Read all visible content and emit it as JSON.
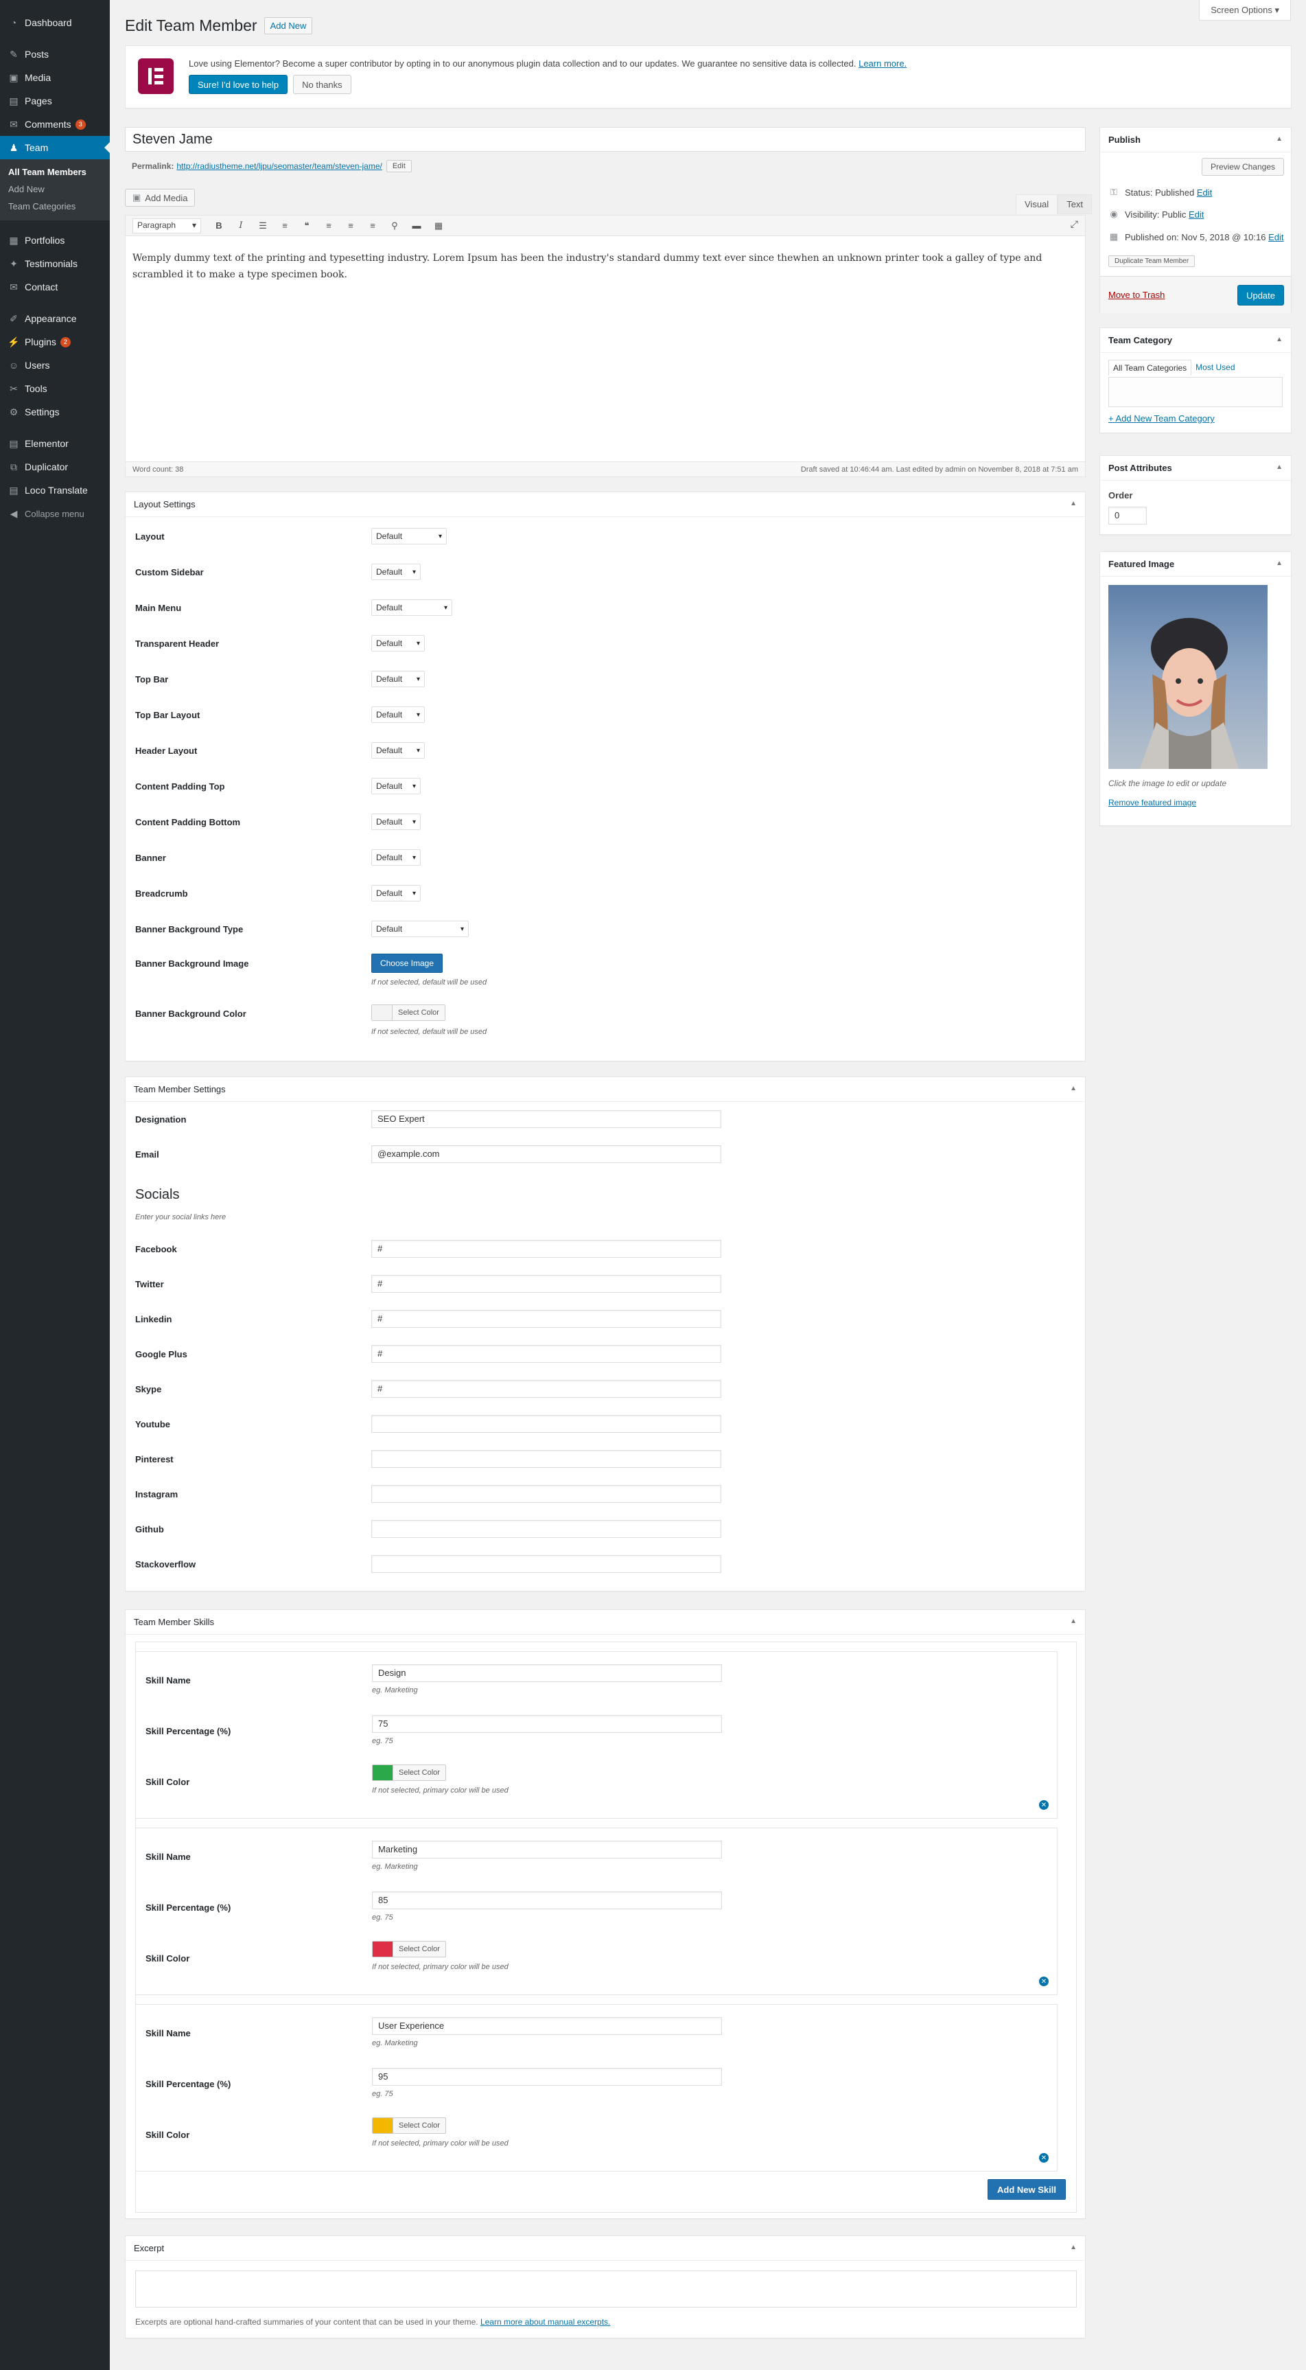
{
  "sidebar": {
    "items": [
      {
        "label": "Dashboard",
        "icon": "dashboard-icon",
        "glyph": "◔"
      },
      {
        "label": "Posts",
        "icon": "pin-icon",
        "glyph": "✎"
      },
      {
        "label": "Media",
        "icon": "media-icon",
        "glyph": "▣"
      },
      {
        "label": "Pages",
        "icon": "pages-icon",
        "glyph": "▤"
      },
      {
        "label": "Comments",
        "icon": "comments-icon",
        "glyph": "✉",
        "badge": "3"
      },
      {
        "label": "Team",
        "icon": "team-icon",
        "glyph": "♟"
      },
      {
        "label": "Portfolios",
        "icon": "portfolio-icon",
        "glyph": "▦"
      },
      {
        "label": "Testimonials",
        "icon": "testimonial-icon",
        "glyph": "✦"
      },
      {
        "label": "Contact",
        "icon": "mail-icon",
        "glyph": "✉"
      },
      {
        "label": "Appearance",
        "icon": "appearance-icon",
        "glyph": "✐"
      },
      {
        "label": "Plugins",
        "icon": "plugins-icon",
        "glyph": "⚡",
        "badge": "2"
      },
      {
        "label": "Users",
        "icon": "users-icon",
        "glyph": "☺"
      },
      {
        "label": "Tools",
        "icon": "tools-icon",
        "glyph": "✂"
      },
      {
        "label": "Settings",
        "icon": "settings-icon",
        "glyph": "⚙"
      },
      {
        "label": "Elementor",
        "icon": "elementor-icon",
        "glyph": "▤"
      },
      {
        "label": "Duplicator",
        "icon": "duplicator-icon",
        "glyph": "⧉"
      },
      {
        "label": "Loco Translate",
        "icon": "translate-icon",
        "glyph": "▤"
      }
    ],
    "submenu": [
      "All Team Members",
      "Add New",
      "Team Categories"
    ],
    "collapse": "Collapse menu"
  },
  "header": {
    "screen_options": "Screen Options ▾",
    "title": "Edit Team Member",
    "add_new": "Add New"
  },
  "notice": {
    "text": "Love using Elementor? Become a super contributor by opting in to our anonymous plugin data collection and to our updates. We guarantee no sensitive data is collected.",
    "learn_more": "Learn more.",
    "accept": "Sure! I'd love to help",
    "decline": "No thanks"
  },
  "post": {
    "title": "Steven Jame",
    "permalink_label": "Permalink:",
    "permalink_url": "http://radiustheme.net/ljpu/seomaster/team/steven-jame/",
    "edit": "Edit"
  },
  "editor": {
    "add_media": "Add Media",
    "tab_visual": "Visual",
    "tab_text": "Text",
    "format": "Paragraph",
    "content": "Wemply dummy text of the printing and typesetting industry. Lorem Ipsum has been the industry's standard dummy text ever since thewhen an unknown printer took a galley of type and scrambled it to make a type specimen book.",
    "word_count": "Word count: 38",
    "draft_saved": "Draft saved at 10:46:44 am. Last edited by admin on November 8, 2018 at 7:51 am"
  },
  "layout_settings": {
    "title": "Layout Settings",
    "rows": [
      {
        "label": "Layout",
        "value": "Default"
      },
      {
        "label": "Custom Sidebar",
        "value": "Default"
      },
      {
        "label": "Main Menu",
        "value": "Default"
      },
      {
        "label": "Transparent Header",
        "value": "Default"
      },
      {
        "label": "Top Bar",
        "value": "Default"
      },
      {
        "label": "Top Bar Layout",
        "value": "Default"
      },
      {
        "label": "Header Layout",
        "value": "Default"
      },
      {
        "label": "Content Padding Top",
        "value": "Default"
      },
      {
        "label": "Content Padding Bottom",
        "value": "Default"
      },
      {
        "label": "Banner",
        "value": "Default"
      },
      {
        "label": "Breadcrumb",
        "value": "Default"
      },
      {
        "label": "Banner Background Type",
        "value": "Default"
      }
    ],
    "bg_image_label": "Banner Background Image",
    "choose_image": "Choose Image",
    "bg_image_help": "If not selected, default will be used",
    "bg_color_label": "Banner Background Color",
    "select_color": "Select Color",
    "bg_color_help": "If not selected, default will be used"
  },
  "member_settings": {
    "title": "Team Member Settings",
    "designation_label": "Designation",
    "designation": "SEO Expert",
    "email_label": "Email",
    "email": "@example.com",
    "socials_title": "Socials",
    "socials_help": "Enter your social links here",
    "socials": [
      {
        "label": "Facebook",
        "value": "#"
      },
      {
        "label": "Twitter",
        "value": "#"
      },
      {
        "label": "Linkedin",
        "value": "#"
      },
      {
        "label": "Google Plus",
        "value": "#"
      },
      {
        "label": "Skype",
        "value": "#"
      },
      {
        "label": "Youtube",
        "value": ""
      },
      {
        "label": "Pinterest",
        "value": ""
      },
      {
        "label": "Instagram",
        "value": ""
      },
      {
        "label": "Github",
        "value": ""
      },
      {
        "label": "Stackoverflow",
        "value": ""
      }
    ]
  },
  "skills": {
    "title": "Team Member Skills",
    "name_label": "Skill Name",
    "name_help": "eg. Marketing",
    "pct_label": "Skill Percentage (%)",
    "pct_help": "eg. 75",
    "color_label": "Skill Color",
    "color_help": "If not selected, primary color will be used",
    "select_color": "Select Color",
    "items": [
      {
        "name": "Design",
        "percent": "75",
        "color": "#2aa84a"
      },
      {
        "name": "Marketing",
        "percent": "85",
        "color": "#dd2f45"
      },
      {
        "name": "User Experience",
        "percent": "95",
        "color": "#f3b700"
      }
    ],
    "add_new": "Add New Skill"
  },
  "excerpt": {
    "title": "Excerpt",
    "help": "Excerpts are optional hand-crafted summaries of your content that can be used in your theme.",
    "learn_more": "Learn more about manual excerpts."
  },
  "publish": {
    "title": "Publish",
    "preview": "Preview Changes",
    "status_label": "Status:",
    "status": "Published",
    "visibility_label": "Visibility:",
    "visibility": "Public",
    "published_label": "Published on:",
    "published": "Nov 5, 2018 @ 10:16",
    "edit": "Edit",
    "duplicate": "Duplicate Team Member",
    "trash": "Move to Trash",
    "update": "Update"
  },
  "category": {
    "title": "Team Category",
    "tab_all": "All Team Categories",
    "tab_most": "Most Used",
    "add_new": "+ Add New Team Category"
  },
  "attributes": {
    "title": "Post Attributes",
    "order_label": "Order",
    "order": "0"
  },
  "featured": {
    "title": "Featured Image",
    "help": "Click the image to edit or update",
    "remove": "Remove featured image"
  }
}
